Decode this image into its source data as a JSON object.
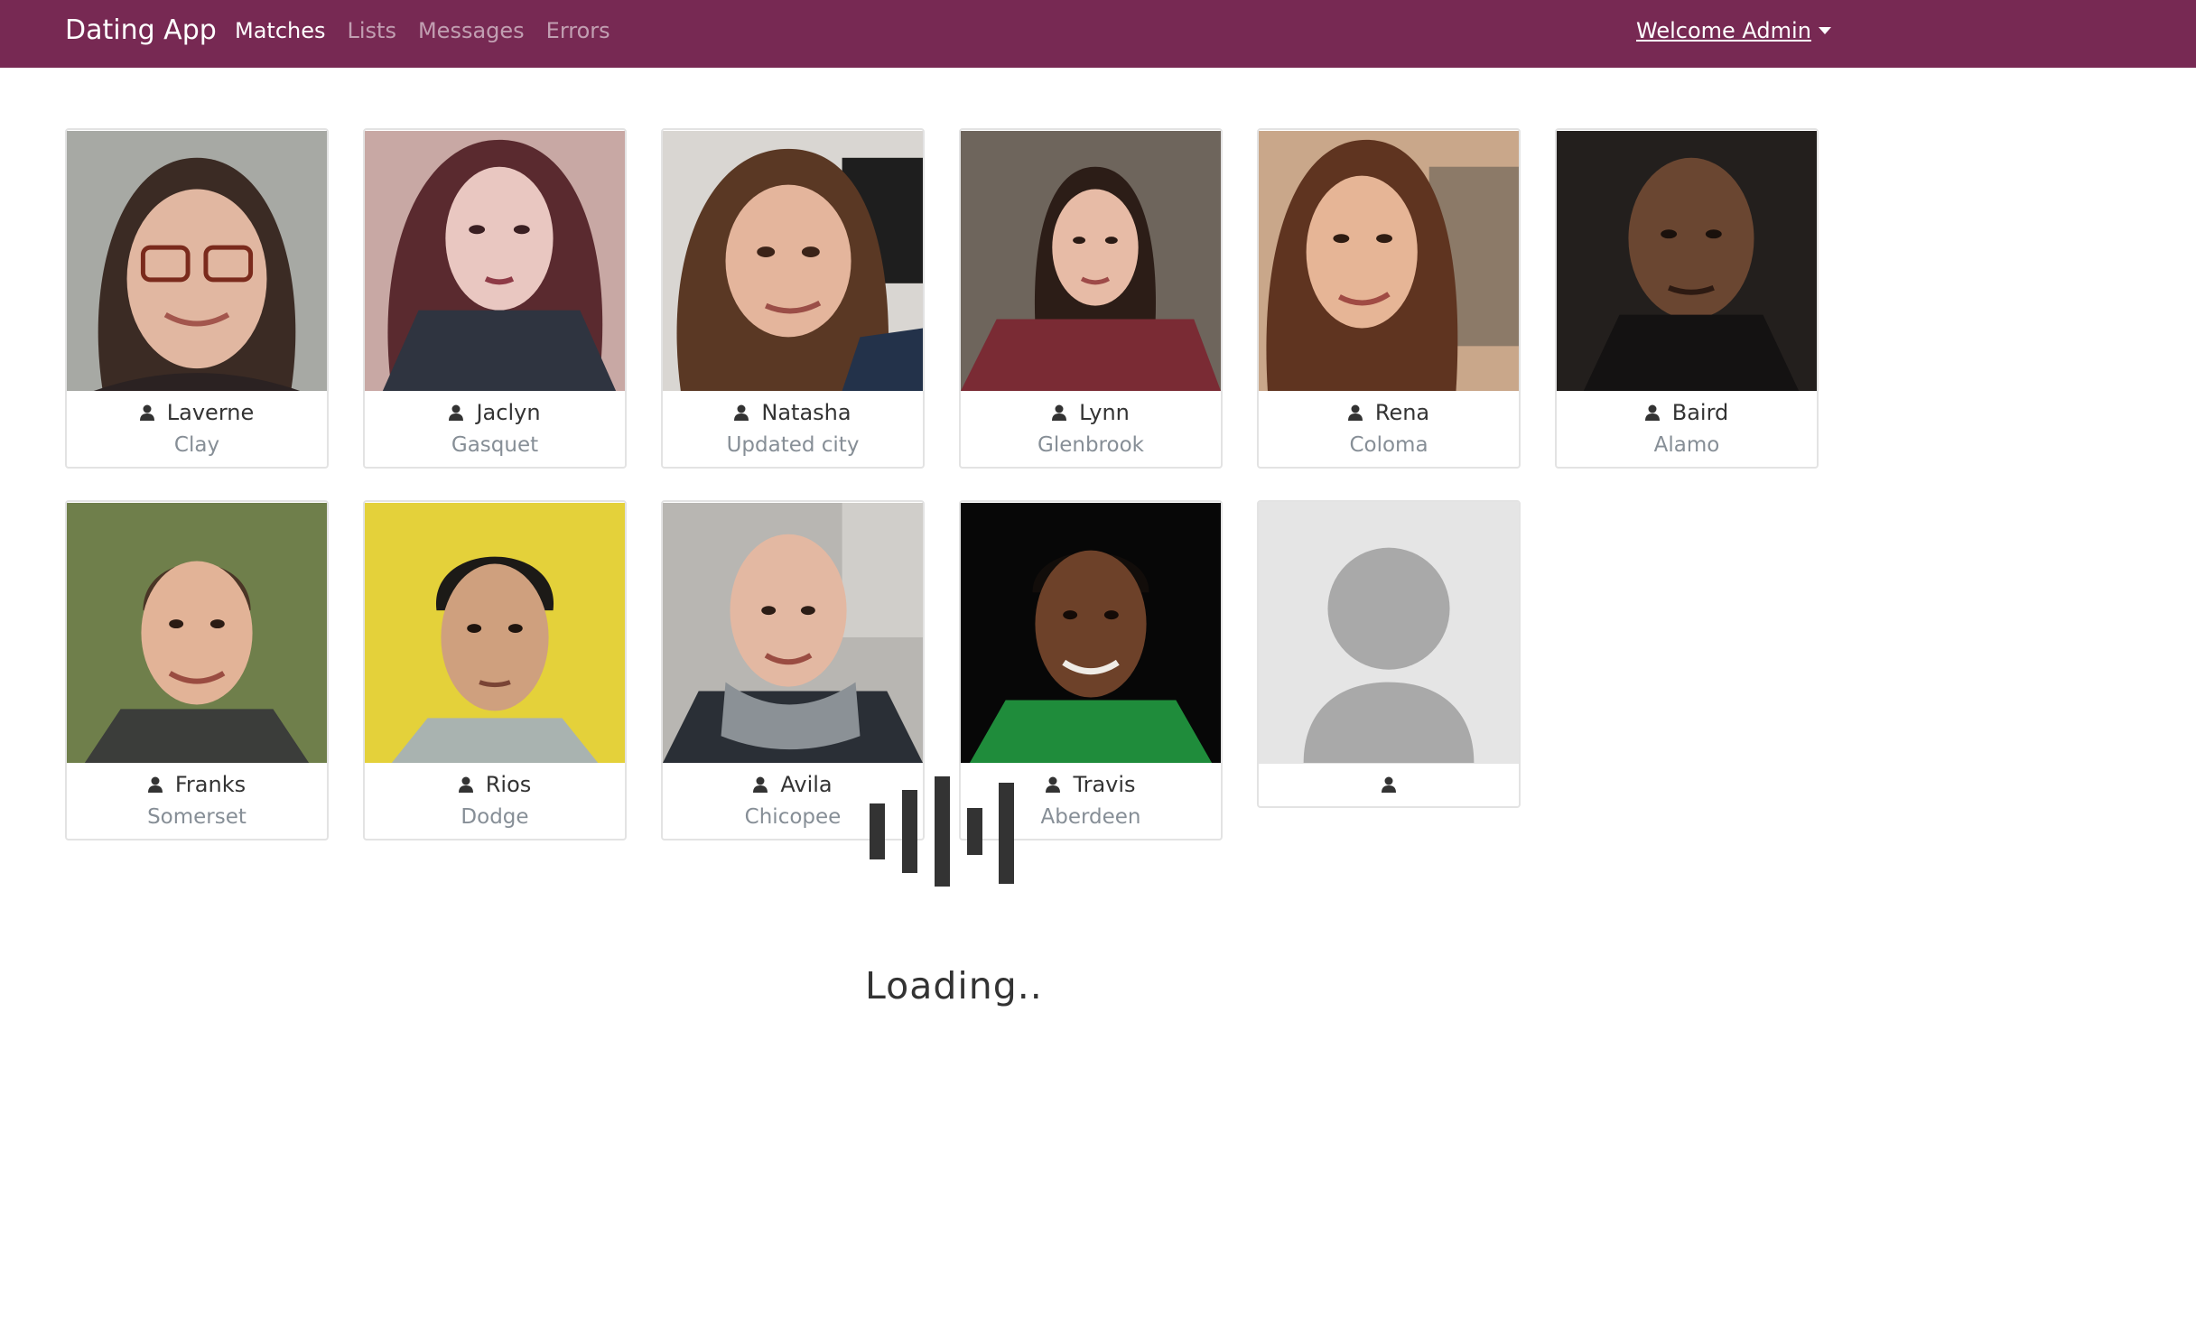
{
  "navbar": {
    "brand": "Dating App",
    "links": [
      "Matches",
      "Lists",
      "Messages",
      "Errors"
    ],
    "active": "Matches",
    "user_menu": "Welcome Admin",
    "color": "#772953"
  },
  "members": [
    {
      "name": "Laverne",
      "city": "Clay"
    },
    {
      "name": "Jaclyn",
      "city": "Gasquet"
    },
    {
      "name": "Natasha",
      "city": "Updated city"
    },
    {
      "name": "Lynn",
      "city": "Glenbrook"
    },
    {
      "name": "Rena",
      "city": "Coloma"
    },
    {
      "name": "Baird",
      "city": "Alamo"
    },
    {
      "name": "Franks",
      "city": "Somerset"
    },
    {
      "name": "Rios",
      "city": "Dodge"
    },
    {
      "name": "Avila",
      "city": "Chicopee"
    },
    {
      "name": "Travis",
      "city": "Aberdeen"
    },
    {
      "name": "",
      "city": ""
    }
  ],
  "loading": {
    "text": "Loading.."
  },
  "icons": {
    "card_user": "user-icon",
    "menu_caret": "caret-down-icon"
  }
}
